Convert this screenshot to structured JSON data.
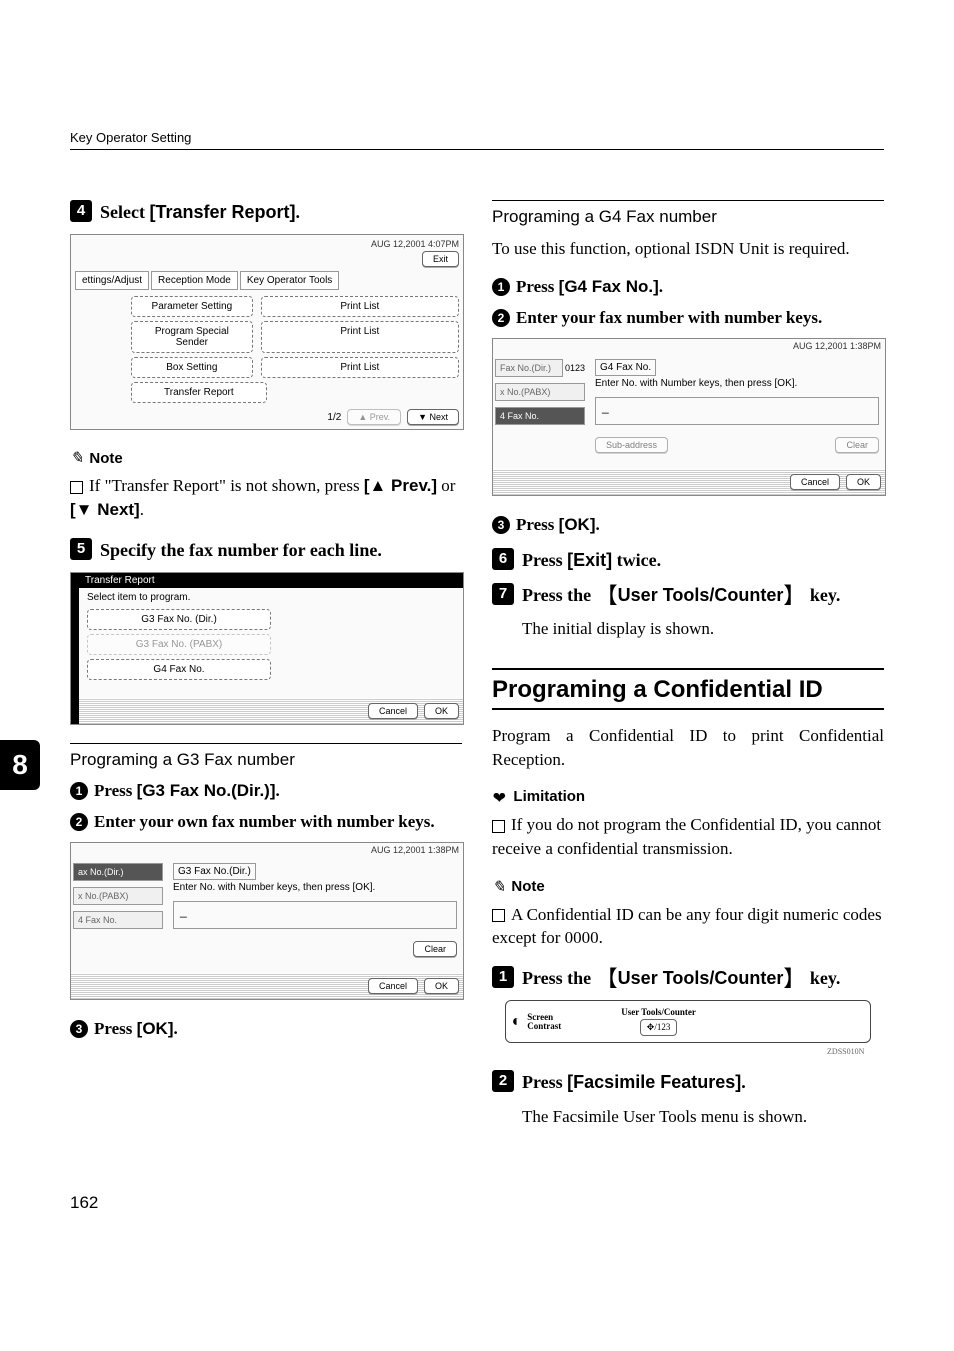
{
  "running_head": "Key Operator Setting",
  "chapter_tab": "8",
  "page_number": "162",
  "left": {
    "step4": {
      "num": "4",
      "lead": "Select ",
      "ui": "[Transfer Report]",
      "tail": "."
    },
    "shot1": {
      "datetime": "AUG   12,2001  4:07PM",
      "exit": "Exit",
      "tabs": [
        "ettings/Adjust",
        "Reception Mode",
        "Key Operator Tools"
      ],
      "rows": [
        [
          "Parameter Setting",
          "Print List"
        ],
        [
          "Program Special Sender",
          "Print List"
        ],
        [
          "Box Setting",
          "Print List"
        ],
        [
          "Transfer Report",
          ""
        ]
      ],
      "pager": "1/2",
      "prev": "▲ Prev.",
      "next": "▼ Next"
    },
    "note_label": "Note",
    "note_body_1": "If \"Transfer Report\" is not shown, press ",
    "note_prev": "[▲ Prev.]",
    "note_or": " or ",
    "note_next": "[▼ Next]",
    "note_body_2": ".",
    "step5": {
      "num": "5",
      "text": "Specify the fax number for each line."
    },
    "shot2": {
      "title": "Transfer Report",
      "sub": "Select item to program.",
      "buttons": [
        "G3 Fax No. (Dir.)",
        "G3 Fax No. (PABX)",
        "G4 Fax No."
      ],
      "cancel": "Cancel",
      "ok": "OK"
    },
    "g3_heading": "Programing a G3 Fax number",
    "g3_sub1": {
      "num": "1",
      "lead": "Press ",
      "ui": "[G3 Fax No.(Dir.)]",
      "tail": "."
    },
    "g3_sub2": {
      "num": "2",
      "text": "Enter your own fax number with number keys."
    },
    "shot3": {
      "datetime": "AUG   12,2001  1:38PM",
      "field": "G3 Fax No.(Dir.)",
      "instr": "Enter No. with Number keys, then press [OK].",
      "sides": [
        "ax No.(Dir.)",
        "x No.(PABX)",
        "4 Fax No."
      ],
      "entry": "_",
      "clear": "Clear",
      "cancel": "Cancel",
      "ok": "OK"
    },
    "g3_sub3": {
      "num": "3",
      "lead": "Press ",
      "ui": "[OK]",
      "tail": "."
    }
  },
  "right": {
    "g4_heading": "Programing a G4 Fax number",
    "g4_intro": "To use this function, optional ISDN Unit is required.",
    "g4_sub1": {
      "num": "1",
      "lead": "Press ",
      "ui": "[G4 Fax No.]",
      "tail": "."
    },
    "g4_sub2": {
      "num": "2",
      "text": "Enter your fax number with number keys."
    },
    "shot4": {
      "datetime": "AUG   12,2001  1:38PM",
      "field": "G4 Fax No.",
      "instr": "Enter No. with Number keys, then press [OK].",
      "sides": [
        "Fax No.(Dir.)",
        "x No.(PABX)",
        "4 Fax No."
      ],
      "side_num": "0123",
      "entry": "_",
      "sub_addr": "Sub-address",
      "clear": "Clear",
      "cancel": "Cancel",
      "ok": "OK"
    },
    "g4_sub3": {
      "num": "3",
      "lead": "Press ",
      "ui": "[OK]",
      "tail": "."
    },
    "step6": {
      "num": "6",
      "lead": "Press ",
      "ui": "[Exit]",
      "tail": " twice."
    },
    "step7": {
      "num": "7",
      "lead": "Press the ",
      "key": "User Tools/Counter",
      "tail": " key."
    },
    "step7_body": "The initial display is shown.",
    "h2": "Programing a Confidential ID",
    "h2_body": "Program a Confidential ID to print Confidential Reception.",
    "limitation_label": "Limitation",
    "limitation_body": "If you do not program the Confidential ID, you cannot receive a confidential transmission.",
    "note_label": "Note",
    "note_body": "A Confidential ID can be any four digit numeric codes except for 0000.",
    "stepA1": {
      "num": "1",
      "lead": "Press the ",
      "key": "User Tools/Counter",
      "tail": " key."
    },
    "panel": {
      "left_small": "Screen",
      "left_small2": "Contrast",
      "center_small": "User  Tools/Counter",
      "btn_glyph": "✥/123",
      "code": "ZDSS010N"
    },
    "stepA2": {
      "num": "2",
      "lead": "Press ",
      "ui": "[Facsimile Features]",
      "tail": "."
    },
    "stepA2_body": "The Facsimile User Tools menu is shown."
  }
}
